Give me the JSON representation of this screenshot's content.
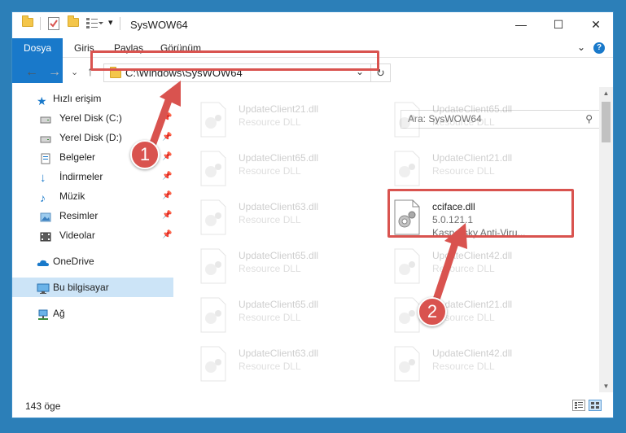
{
  "window": {
    "title": "SysWOW64"
  },
  "title_controls": {
    "minimize": "—",
    "maximize": "☐",
    "close": "✕"
  },
  "ribbon": {
    "tabs": [
      "Dosya",
      "Giriş",
      "Paylaş",
      "Görünüm"
    ],
    "expand": "⌄",
    "help": "?"
  },
  "navigation": {
    "back": "←",
    "forward": "→",
    "recent": "⌄",
    "up": "↑",
    "address": "C:\\Windows\\SysWOW64",
    "refresh": "↻"
  },
  "search": {
    "placeholder": "Ara: SysWOW64"
  },
  "sidebar": {
    "items": [
      {
        "label": "Hızlı erişim",
        "icon": "star-icon",
        "pinned": false
      },
      {
        "label": "Yerel Disk (C:)",
        "icon": "drive-icon",
        "pinned": true
      },
      {
        "label": "Yerel Disk (D:)",
        "icon": "drive-icon",
        "pinned": true
      },
      {
        "label": "Belgeler",
        "icon": "documents-icon",
        "pinned": true
      },
      {
        "label": "İndirmeler",
        "icon": "download-icon",
        "pinned": true
      },
      {
        "label": "Müzik",
        "icon": "music-icon",
        "pinned": true
      },
      {
        "label": "Resimler",
        "icon": "pictures-icon",
        "pinned": true
      },
      {
        "label": "Videolar",
        "icon": "videos-icon",
        "pinned": true
      },
      {
        "label": "OneDrive",
        "icon": "onedrive-icon",
        "pinned": false
      },
      {
        "label": "Bu bilgisayar",
        "icon": "computer-icon",
        "pinned": false,
        "selected": true
      },
      {
        "label": "Ağ",
        "icon": "network-icon",
        "pinned": false
      }
    ]
  },
  "files": [
    {
      "name": "UpdateClient21.dll",
      "line2": "Resource DLL"
    },
    {
      "name": "UpdateClient65.dll",
      "line2": "Resource DLL"
    },
    {
      "name": "UpdateClient65.dll",
      "line2": "Resource DLL"
    },
    {
      "name": "UpdateClient21.dll",
      "line2": "Resource DLL"
    },
    {
      "name": "UpdateClient63.dll",
      "line2": "Resource DLL"
    },
    {
      "name": "cciface.dll",
      "line2": "5.0.121.1",
      "line3": "Kaspersky Anti-Viru...",
      "highlighted": true
    },
    {
      "name": "UpdateClient65.dll",
      "line2": "Resource DLL"
    },
    {
      "name": "UpdateClient42.dll",
      "line2": "Resource DLL"
    },
    {
      "name": "UpdateClient65.dll",
      "line2": "Resource DLL"
    },
    {
      "name": "UpdateClient21.dll",
      "line2": "Resource DLL"
    },
    {
      "name": "UpdateClient63.dll",
      "line2": "Resource DLL"
    },
    {
      "name": "UpdateClient42.dll",
      "line2": "Resource DLL"
    }
  ],
  "status": {
    "count": "143 öge"
  },
  "annotations": {
    "badge1": "1",
    "badge2": "2"
  },
  "colors": {
    "accent": "#1979ca",
    "highlight": "#d9534f",
    "selection": "#cce4f7"
  }
}
